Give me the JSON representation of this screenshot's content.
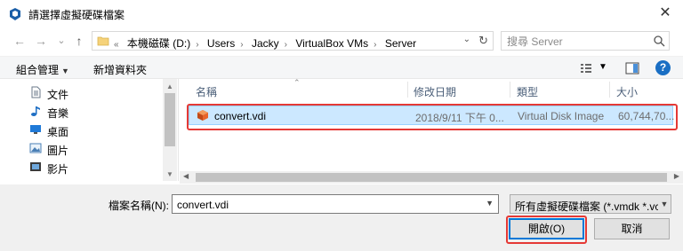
{
  "window": {
    "title": "請選擇虛擬硬碟檔案",
    "app_icon": "virtualbox-icon",
    "close_glyph": "✕"
  },
  "nav": {
    "back_glyph": "←",
    "forward_glyph": "→",
    "recent_glyph": "⌄",
    "up_glyph": "↑",
    "breadcrumb_overflow": "«",
    "breadcrumb": [
      "本機磁碟 (D:)",
      "Users",
      "Jacky",
      "VirtualBox VMs",
      "Server"
    ],
    "breadcrumb_sep": "›",
    "search_placeholder": "搜尋 Server"
  },
  "toolbar": {
    "organize": "組合管理",
    "new_folder": "新增資料夾",
    "help": "?"
  },
  "sidebar": {
    "items": [
      {
        "label": "文件",
        "icon": "document-icon"
      },
      {
        "label": "音樂",
        "icon": "music-icon"
      },
      {
        "label": "桌面",
        "icon": "desktop-icon"
      },
      {
        "label": "圖片",
        "icon": "pictures-icon"
      },
      {
        "label": "影片",
        "icon": "videos-icon"
      }
    ]
  },
  "filelist": {
    "columns": [
      "名稱",
      "修改日期",
      "類型",
      "大小"
    ],
    "rows": [
      {
        "name": "convert.vdi",
        "modified": "2018/9/11 下午 0...",
        "type": "Virtual Disk Image",
        "size": "60,744,70..."
      }
    ]
  },
  "bottom": {
    "filename_label": "檔案名稱(N):",
    "filename_value": "convert.vdi",
    "filter": "所有虛擬硬碟檔案 (*.vmdk *.vc",
    "open": "開啟(O)",
    "cancel": "取消"
  },
  "colors": {
    "selection_bg": "#cce8ff",
    "highlight_border": "#e53935",
    "accent": "#0078d7"
  }
}
